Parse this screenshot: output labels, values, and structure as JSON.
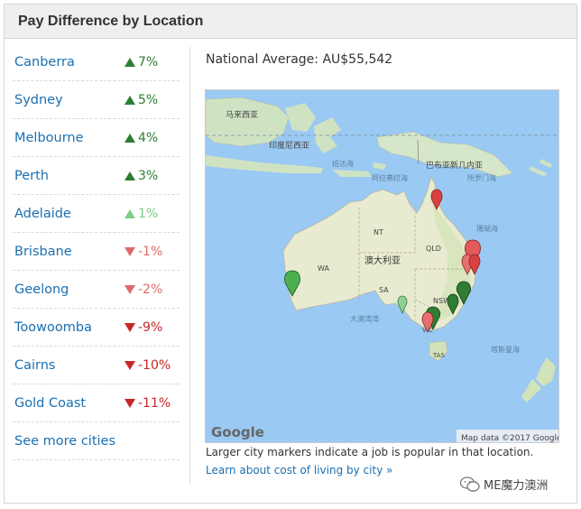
{
  "header": {
    "title": "Pay Difference by Location"
  },
  "cities": [
    {
      "name": "Canberra",
      "change": "7%",
      "direction": "up",
      "color": "#2e7d32"
    },
    {
      "name": "Sydney",
      "change": "5%",
      "direction": "up",
      "color": "#2e7d32"
    },
    {
      "name": "Melbourne",
      "change": "4%",
      "direction": "up",
      "color": "#2e7d32"
    },
    {
      "name": "Perth",
      "change": "3%",
      "direction": "up",
      "color": "#2e7d32"
    },
    {
      "name": "Adelaide",
      "change": "1%",
      "direction": "up",
      "color": "#7ccf86"
    },
    {
      "name": "Brisbane",
      "change": "-1%",
      "direction": "down",
      "color": "#e06a6a"
    },
    {
      "name": "Geelong",
      "change": "-2%",
      "direction": "down",
      "color": "#e06a6a"
    },
    {
      "name": "Toowoomba",
      "change": "-9%",
      "direction": "down",
      "color": "#c62828"
    },
    {
      "name": "Cairns",
      "change": "-10%",
      "direction": "down",
      "color": "#c62828"
    },
    {
      "name": "Gold Coast",
      "change": "-11%",
      "direction": "down",
      "color": "#c62828"
    }
  ],
  "see_more": "See more cities",
  "national_average": "National Average: AU$55,542",
  "map": {
    "labels": {
      "malaysia": "马来西亚",
      "indonesia": "印度尼西亚",
      "banda_sea": "班达海",
      "arafura_sea": "阿拉弗拉海",
      "png": "巴布亚新几内亚",
      "solomon_sea": "所罗门海",
      "coral_sea": "珊瑚海",
      "australia": "澳大利亚",
      "nt": "NT",
      "qld": "QLD",
      "wa": "WA",
      "sa": "SA",
      "nsw": "NSW",
      "vic": "VIC",
      "tas": "TAS",
      "great_australian_bight": "大澳湾湾",
      "tasman_sea": "塔斯曼海"
    },
    "logo": "Google",
    "attribution": "Map data ©2017 Google"
  },
  "caption": "Larger city markers indicate a job is popular in that location.",
  "link": "Learn about cost of living by city »",
  "watermark": "ME魔力澳洲"
}
